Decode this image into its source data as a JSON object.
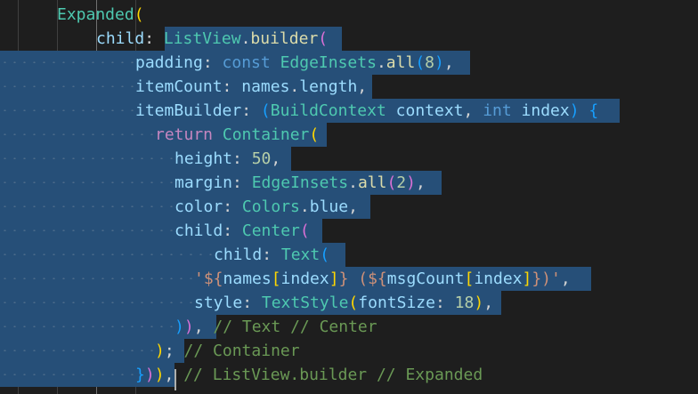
{
  "editor": {
    "lines": [
      {
        "tokens": [
          {
            "t": "Expanded",
            "c": "k"
          },
          {
            "t": "(",
            "c": "b1"
          }
        ]
      },
      {
        "tokens": [
          {
            "t": "child",
            "c": "p"
          },
          {
            "t": ": "
          },
          {
            "t": "ListView",
            "c": "k"
          },
          {
            "t": "."
          },
          {
            "t": "builder",
            "c": "f"
          },
          {
            "t": "(",
            "c": "b2"
          }
        ]
      },
      {
        "tokens": [
          {
            "t": "padding",
            "c": "p"
          },
          {
            "t": ": "
          },
          {
            "t": "const ",
            "c": "kw"
          },
          {
            "t": "EdgeInsets",
            "c": "k"
          },
          {
            "t": "."
          },
          {
            "t": "all",
            "c": "f"
          },
          {
            "t": "(",
            "c": "b3"
          },
          {
            "t": "8",
            "c": "n"
          },
          {
            "t": ")",
            "c": "b3"
          },
          {
            "t": ","
          }
        ]
      },
      {
        "tokens": [
          {
            "t": "itemCount",
            "c": "p"
          },
          {
            "t": ": "
          },
          {
            "t": "names",
            "c": "p"
          },
          {
            "t": "."
          },
          {
            "t": "length",
            "c": "p"
          },
          {
            "t": ","
          }
        ]
      },
      {
        "tokens": [
          {
            "t": "itemBuilder",
            "c": "p"
          },
          {
            "t": ": "
          },
          {
            "t": "(",
            "c": "b3"
          },
          {
            "t": "BuildContext ",
            "c": "k"
          },
          {
            "t": "context",
            "c": "p"
          },
          {
            "t": ", "
          },
          {
            "t": "int ",
            "c": "kw"
          },
          {
            "t": "index",
            "c": "p"
          },
          {
            "t": ")",
            "c": "b3"
          },
          {
            "t": " "
          },
          {
            "t": "{",
            "c": "b3"
          }
        ]
      },
      {
        "tokens": [
          {
            "t": "return ",
            "c": "ret"
          },
          {
            "t": "Container",
            "c": "k"
          },
          {
            "t": "(",
            "c": "b1"
          }
        ]
      },
      {
        "tokens": [
          {
            "t": "height",
            "c": "p"
          },
          {
            "t": ": "
          },
          {
            "t": "50",
            "c": "n"
          },
          {
            "t": ","
          }
        ]
      },
      {
        "tokens": [
          {
            "t": "margin",
            "c": "p"
          },
          {
            "t": ": "
          },
          {
            "t": "EdgeInsets",
            "c": "k"
          },
          {
            "t": "."
          },
          {
            "t": "all",
            "c": "f"
          },
          {
            "t": "(",
            "c": "b2"
          },
          {
            "t": "2",
            "c": "n"
          },
          {
            "t": ")",
            "c": "b2"
          },
          {
            "t": ","
          }
        ]
      },
      {
        "tokens": [
          {
            "t": "color",
            "c": "p"
          },
          {
            "t": ": "
          },
          {
            "t": "Colors",
            "c": "k"
          },
          {
            "t": "."
          },
          {
            "t": "blue",
            "c": "p"
          },
          {
            "t": ","
          }
        ]
      },
      {
        "tokens": [
          {
            "t": "child",
            "c": "p"
          },
          {
            "t": ": "
          },
          {
            "t": "Center",
            "c": "k"
          },
          {
            "t": "(",
            "c": "b2"
          }
        ]
      },
      {
        "tokens": [
          {
            "t": "child",
            "c": "p"
          },
          {
            "t": ": "
          },
          {
            "t": "Text",
            "c": "k"
          },
          {
            "t": "(",
            "c": "b3"
          }
        ]
      },
      {
        "tokens": [
          {
            "t": "'${",
            "c": "s"
          },
          {
            "t": "names",
            "c": "p"
          },
          {
            "t": "[",
            "c": "b1"
          },
          {
            "t": "index",
            "c": "p"
          },
          {
            "t": "]",
            "c": "b1"
          },
          {
            "t": "} (${",
            "c": "s"
          },
          {
            "t": "msgCount",
            "c": "p"
          },
          {
            "t": "[",
            "c": "b1"
          },
          {
            "t": "index",
            "c": "p"
          },
          {
            "t": "]",
            "c": "b1"
          },
          {
            "t": "})'",
            "c": "s"
          },
          {
            "t": ","
          }
        ]
      },
      {
        "tokens": [
          {
            "t": "style",
            "c": "p"
          },
          {
            "t": ": "
          },
          {
            "t": "TextStyle",
            "c": "k"
          },
          {
            "t": "(",
            "c": "b1"
          },
          {
            "t": "fontSize",
            "c": "p"
          },
          {
            "t": ": "
          },
          {
            "t": "18",
            "c": "n"
          },
          {
            "t": ")",
            "c": "b1"
          },
          {
            "t": ","
          }
        ]
      },
      {
        "tokens": [
          {
            "t": ")",
            "c": "b3"
          },
          {
            "t": ")",
            "c": "b2"
          },
          {
            "t": ", "
          },
          {
            "t": "// Text // Center",
            "c": "c"
          }
        ]
      },
      {
        "tokens": [
          {
            "t": ")",
            "c": "b1"
          },
          {
            "t": "; "
          },
          {
            "t": "// Container",
            "c": "c"
          }
        ]
      },
      {
        "tokens": [
          {
            "t": "}",
            "c": "b3"
          },
          {
            "t": ")",
            "c": "b2"
          },
          {
            "t": ")",
            "c": "b1"
          },
          {
            "t": ", "
          },
          {
            "t": "// ListView.builder // Expanded",
            "c": "c"
          }
        ]
      }
    ]
  }
}
